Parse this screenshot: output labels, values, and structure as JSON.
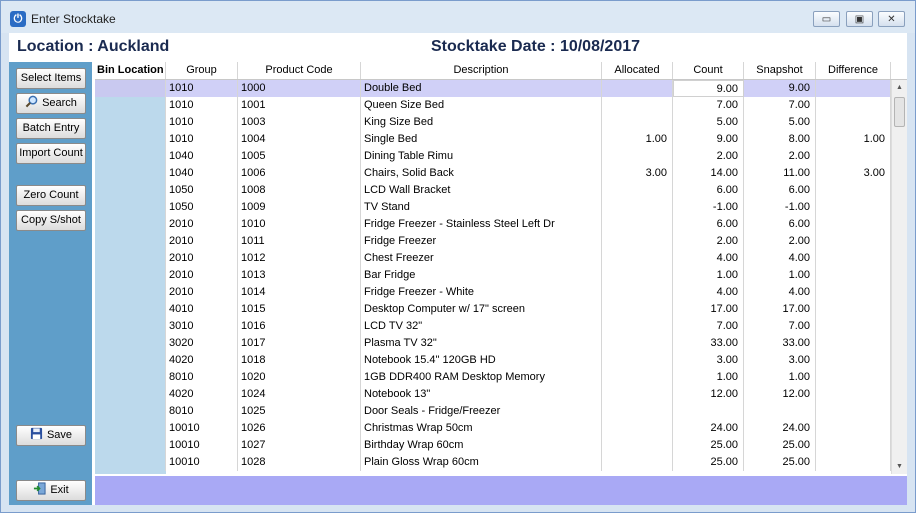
{
  "window": {
    "title": "Enter Stocktake",
    "minimize": "▭",
    "maximize": "▣",
    "close": "✕"
  },
  "header": {
    "location": "Location : Auckland",
    "stocktake_date": "Stocktake Date :  10/08/2017"
  },
  "sidebar": {
    "select_items": "Select Items",
    "search": "Search",
    "batch_entry": "Batch Entry",
    "import_count": "Import Count",
    "zero_count": "Zero Count",
    "copy_snapshot": "Copy S/shot",
    "save": "Save",
    "exit": "Exit"
  },
  "table": {
    "columns": [
      "Bin Location",
      "Group",
      "Product Code",
      "Description",
      "Allocated",
      "Count",
      "Snapshot",
      "Difference"
    ],
    "rows": [
      [
        "",
        "1010",
        "1000",
        "Double Bed",
        "",
        "9.00",
        "9.00",
        ""
      ],
      [
        "",
        "1010",
        "1001",
        "Queen Size Bed",
        "",
        "7.00",
        "7.00",
        ""
      ],
      [
        "",
        "1010",
        "1003",
        "King Size Bed",
        "",
        "5.00",
        "5.00",
        ""
      ],
      [
        "",
        "1010",
        "1004",
        "Single Bed",
        "1.00",
        "9.00",
        "8.00",
        "1.00"
      ],
      [
        "",
        "1040",
        "1005",
        "Dining Table Rimu",
        "",
        "2.00",
        "2.00",
        ""
      ],
      [
        "",
        "1040",
        "1006",
        "Chairs, Solid Back",
        "3.00",
        "14.00",
        "11.00",
        "3.00"
      ],
      [
        "",
        "1050",
        "1008",
        "LCD Wall Bracket",
        "",
        "6.00",
        "6.00",
        ""
      ],
      [
        "",
        "1050",
        "1009",
        "TV Stand",
        "",
        "-1.00",
        "-1.00",
        ""
      ],
      [
        "",
        "2010",
        "1010",
        "Fridge Freezer - Stainless Steel Left Dr",
        "",
        "6.00",
        "6.00",
        ""
      ],
      [
        "",
        "2010",
        "1011",
        "Fridge Freezer",
        "",
        "2.00",
        "2.00",
        ""
      ],
      [
        "",
        "2010",
        "1012",
        "Chest Freezer",
        "",
        "4.00",
        "4.00",
        ""
      ],
      [
        "",
        "2010",
        "1013",
        "Bar Fridge",
        "",
        "1.00",
        "1.00",
        ""
      ],
      [
        "",
        "2010",
        "1014",
        "Fridge Freezer - White",
        "",
        "4.00",
        "4.00",
        ""
      ],
      [
        "",
        "4010",
        "1015",
        "Desktop Computer w/ 17\" screen",
        "",
        "17.00",
        "17.00",
        ""
      ],
      [
        "",
        "3010",
        "1016",
        "LCD TV 32\"",
        "",
        "7.00",
        "7.00",
        ""
      ],
      [
        "",
        "3020",
        "1017",
        "Plasma TV 32\"",
        "",
        "33.00",
        "33.00",
        ""
      ],
      [
        "",
        "4020",
        "1018",
        "Notebook 15.4\" 120GB HD",
        "",
        "3.00",
        "3.00",
        ""
      ],
      [
        "",
        "8010",
        "1020",
        "1GB DDR400 RAM Desktop Memory",
        "",
        "1.00",
        "1.00",
        ""
      ],
      [
        "",
        "4020",
        "1024",
        "Notebook  13\"",
        "",
        "12.00",
        "12.00",
        ""
      ],
      [
        "",
        "8010",
        "1025",
        "Door Seals - Fridge/Freezer",
        "",
        "",
        "",
        ""
      ],
      [
        "",
        "10010",
        "1026",
        "Christmas Wrap 50cm",
        "",
        "24.00",
        "24.00",
        ""
      ],
      [
        "",
        "10010",
        "1027",
        "Birthday Wrap 60cm",
        "",
        "25.00",
        "25.00",
        ""
      ],
      [
        "",
        "10010",
        "1028",
        "Plain Gloss Wrap 60cm",
        "",
        "25.00",
        "25.00",
        ""
      ]
    ]
  }
}
